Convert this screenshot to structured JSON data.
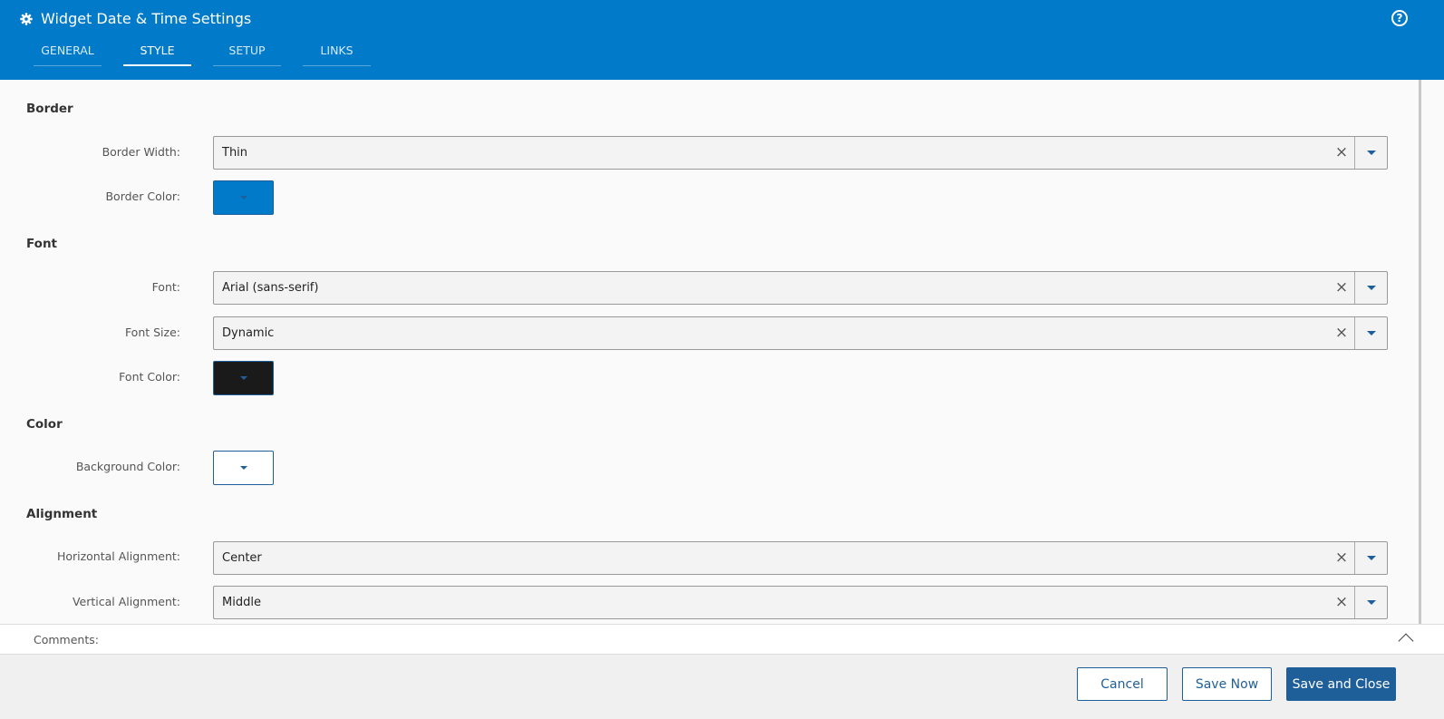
{
  "header": {
    "title": "Widget Date & Time Settings",
    "icon": "gear-icon",
    "help_icon": "question-circle-icon",
    "help_glyph": "?",
    "background": "#007ac9"
  },
  "tabs": [
    {
      "label": "GENERAL",
      "active": false
    },
    {
      "label": "STYLE",
      "active": true
    },
    {
      "label": "SETUP",
      "active": false
    },
    {
      "label": "LINKS",
      "active": false
    }
  ],
  "sections": {
    "border": "Border",
    "font": "Font",
    "color": "Color",
    "alignment": "Alignment"
  },
  "fields": {
    "border_width": {
      "label": "Border Width:",
      "value": "Thin"
    },
    "border_color": {
      "label": "Border Color:",
      "color": "#007ac9"
    },
    "font": {
      "label": "Font:",
      "value": "Arial (sans-serif)"
    },
    "font_size": {
      "label": "Font Size:",
      "value": "Dynamic"
    },
    "font_color": {
      "label": "Font Color:",
      "color": "#1a1a1a"
    },
    "background_color": {
      "label": "Background Color:",
      "color": "#ffffff"
    },
    "horizontal_alignment": {
      "label": "Horizontal Alignment:",
      "value": "Center"
    },
    "vertical_alignment": {
      "label": "Vertical Alignment:",
      "value": "Middle"
    }
  },
  "clear_glyph": "×",
  "comments": {
    "label": "Comments:"
  },
  "footer": {
    "cancel_label": "Cancel",
    "save_now_label": "Save Now",
    "save_close_label": "Save and Close"
  },
  "colors": {
    "accent": "#007ac9",
    "primary_button": "#1f5f99"
  }
}
